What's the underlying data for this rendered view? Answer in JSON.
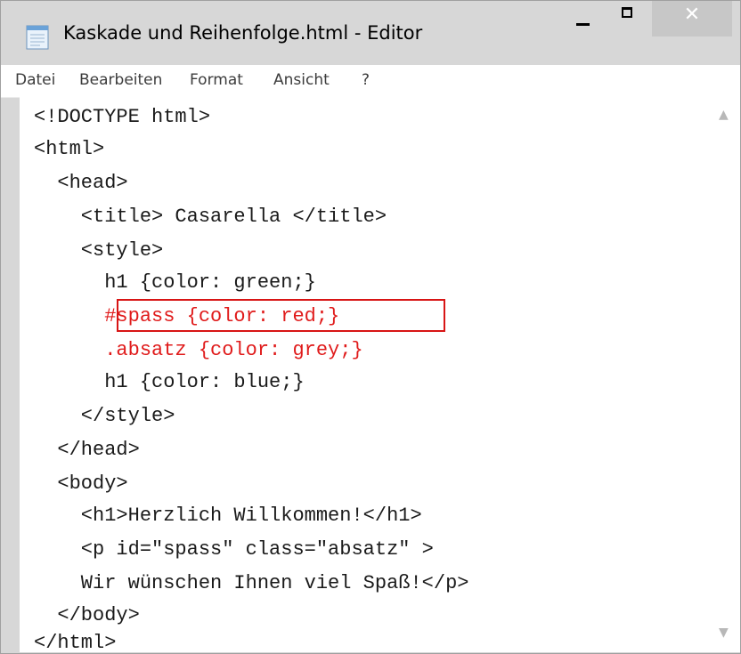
{
  "window": {
    "title": "Kaskade und Reihenfolge.html - Editor",
    "controls": {
      "minimize_glyph": "",
      "maximize_glyph": "",
      "close_glyph": "✕"
    }
  },
  "menu": {
    "items": [
      "Datei",
      "Bearbeiten",
      "Format",
      "Ansicht",
      "?"
    ]
  },
  "editor": {
    "lines": [
      "<!DOCTYPE html>",
      "<html>",
      "  <head>",
      "    <title> Casarella </title>",
      "    <style>",
      "      h1 {color: green;}",
      "      #spass {color: red;}",
      "      .absatz {color: grey;}",
      "      h1 {color: blue;}",
      "    </style>",
      "  </head>",
      "  <body>",
      "    <h1>Herzlich Willkommen!</h1>",
      "    <p id=\"spass\" class=\"absatz\" >",
      "    Wir wünschen Ihnen viel Spaß!</p>",
      "  </body>",
      "</html>"
    ],
    "red_line_indices": [
      6,
      7
    ],
    "highlighted_line_index": 6
  },
  "scrollbar": {
    "up_glyph": "▲",
    "down_glyph": "▼"
  },
  "colors": {
    "titlebar_bg": "#d7d7d7",
    "close_button_bg": "#c7c7c7",
    "editor_bg": "#ffffff",
    "code_text": "#1a1a1a",
    "highlight_red": "#e01b1b",
    "menu_text": "#3c3c3c"
  },
  "icons": {
    "app": "notepad-icon"
  }
}
